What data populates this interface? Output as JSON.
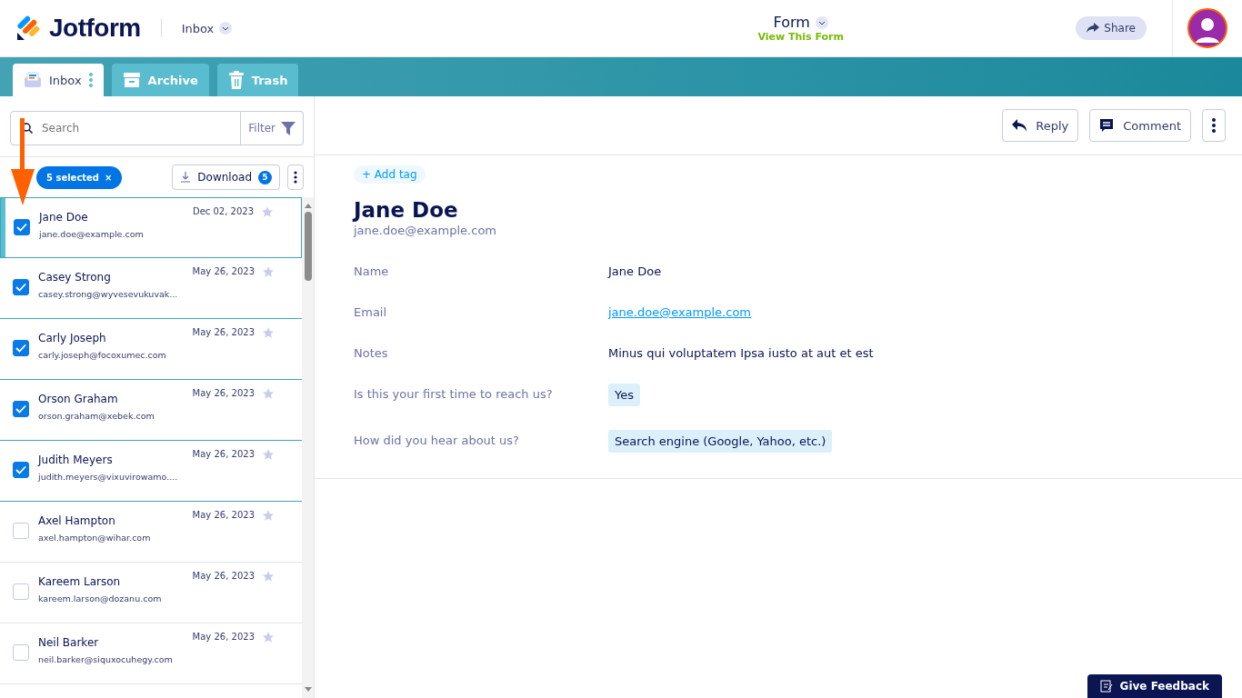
{
  "header": {
    "brand": "Jotform",
    "section": "Inbox",
    "form_title": "Form",
    "form_link": "View This Form",
    "share": "Share"
  },
  "tabs": [
    {
      "label": "Inbox",
      "selected": true
    },
    {
      "label": "Archive",
      "selected": false
    },
    {
      "label": "Trash",
      "selected": false
    }
  ],
  "search": {
    "placeholder": "Search",
    "filter": "Filter"
  },
  "selection": {
    "label": "5 selected",
    "clear": "×",
    "download": "Download",
    "download_count": "5"
  },
  "submissions": [
    {
      "name": "Jane Doe",
      "email": "jane.doe@example.com",
      "date": "Dec 02, 2023",
      "checked": true,
      "selected": true,
      "starred": false
    },
    {
      "name": "Casey Strong",
      "email": "casey.strong@wyvesevukuvak...",
      "date": "May 26, 2023",
      "checked": true,
      "selected": false,
      "starred": false
    },
    {
      "name": "Carly Joseph",
      "email": "carly.joseph@focoxumec.com",
      "date": "May 26, 2023",
      "checked": true,
      "selected": false,
      "starred": false
    },
    {
      "name": "Orson Graham",
      "email": "orson.graham@xebek.com",
      "date": "May 26, 2023",
      "checked": true,
      "selected": false,
      "starred": false
    },
    {
      "name": "Judith Meyers",
      "email": "judith.meyers@vixuvirowamo....",
      "date": "May 26, 2023",
      "checked": true,
      "selected": false,
      "starred": false
    },
    {
      "name": "Axel Hampton",
      "email": "axel.hampton@wihar.com",
      "date": "May 26, 2023",
      "checked": false,
      "selected": false,
      "starred": false
    },
    {
      "name": "Kareem Larson",
      "email": "kareem.larson@dozanu.com",
      "date": "May 26, 2023",
      "checked": false,
      "selected": false,
      "starred": false
    },
    {
      "name": "Neil Barker",
      "email": "neil.barker@siquxocuhegy.com",
      "date": "May 26, 2023",
      "checked": false,
      "selected": false,
      "starred": false
    }
  ],
  "toolbar": {
    "reply": "Reply",
    "comment": "Comment"
  },
  "detail": {
    "add_tag": "+ Add tag",
    "name": "Jane Doe",
    "email": "jane.doe@example.com",
    "fields": [
      {
        "label": "Name",
        "value": "Jane Doe",
        "kind": "text"
      },
      {
        "label": "Email",
        "value": "jane.doe@example.com",
        "kind": "link"
      },
      {
        "label": "Notes",
        "value": "Minus qui voluptatem Ipsa iusto at aut et est",
        "kind": "text"
      },
      {
        "label": "Is this your first time to reach us?",
        "value": "Yes",
        "kind": "chip"
      },
      {
        "label": "How did you hear about us?",
        "value": "Search engine (Google, Yahoo, etc.)",
        "kind": "chip"
      }
    ]
  },
  "feedback": "Give Feedback"
}
